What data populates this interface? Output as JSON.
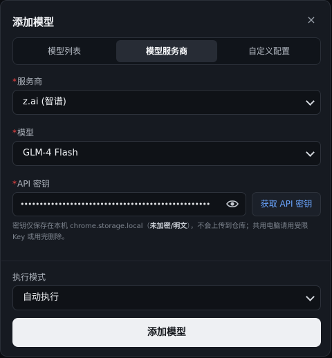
{
  "dialog": {
    "title": "添加模型",
    "close_label": "×"
  },
  "tabs": [
    {
      "label": "模型列表",
      "active": false
    },
    {
      "label": "模型服务商",
      "active": true
    },
    {
      "label": "自定义配置",
      "active": false
    }
  ],
  "provider": {
    "label": "服务商",
    "value": "z.ai (智谱)"
  },
  "model": {
    "label": "模型",
    "value": "GLM-4 Flash"
  },
  "api_key": {
    "label": "API 密钥",
    "masked_value": "••••••••••••••••••••••••••••••••••••••••••••••••••",
    "get_key_label": "获取 API 密钥",
    "hint_before": "密钥仅保存在本机 chrome.storage.local（",
    "hint_bold": "未加密/明文",
    "hint_after": "），不会上传到仓库；共用电脑请用受限 Key 或用完删除。"
  },
  "exec_mode": {
    "label": "执行模式",
    "value": "自动执行"
  },
  "submit_label": "添加模型",
  "colors": {
    "required": "#ef4444",
    "link": "#6aa5ff",
    "primary_button": "#eef0f3"
  }
}
